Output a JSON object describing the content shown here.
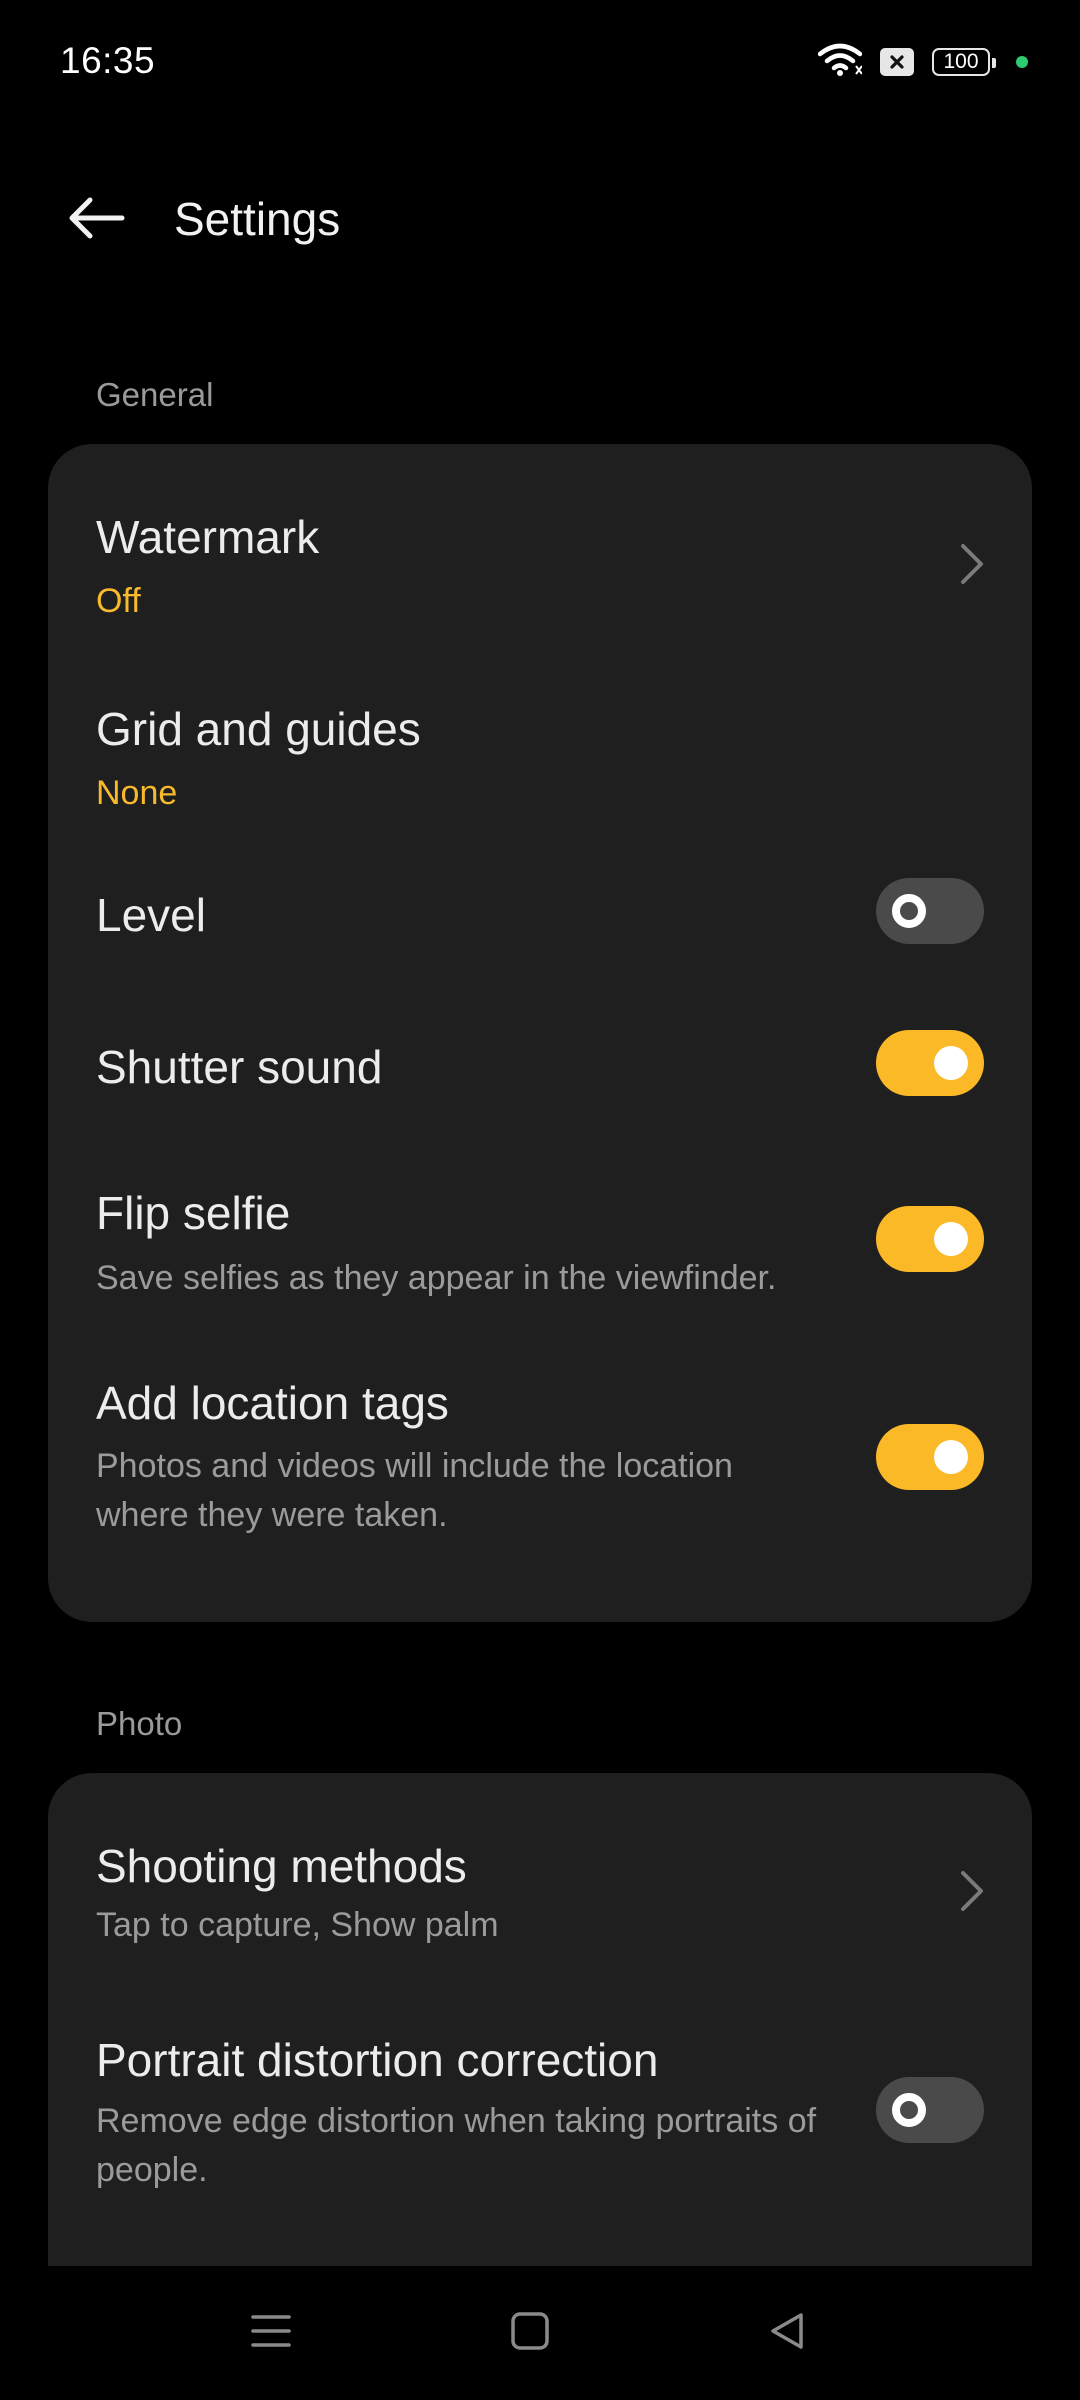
{
  "status_bar": {
    "time": "16:35",
    "battery": "100",
    "icons": [
      "wifi-icon",
      "sim-off-icon",
      "battery-icon",
      "privacy-indicator-dot"
    ]
  },
  "header": {
    "title": "Settings",
    "back_icon": "arrow-left-icon"
  },
  "sections": {
    "general": {
      "label": "General",
      "items": {
        "watermark": {
          "title": "Watermark",
          "value": "Off"
        },
        "grid": {
          "title": "Grid and guides",
          "value": "None"
        },
        "level": {
          "title": "Level",
          "toggle": false
        },
        "shutter": {
          "title": "Shutter sound",
          "toggle": true
        },
        "flip_selfie": {
          "title": "Flip selfie",
          "subtitle": "Save selfies as they appear in the viewfinder.",
          "toggle": true
        },
        "location": {
          "title": "Add location tags",
          "subtitle": "Photos and videos will include the location where they were taken.",
          "toggle": true
        }
      }
    },
    "photo": {
      "label": "Photo",
      "items": {
        "shooting_methods": {
          "title": "Shooting methods",
          "subtitle": "Tap to capture, Show palm"
        },
        "portrait_distortion": {
          "title": "Portrait distortion correction",
          "subtitle": "Remove edge distortion when taking portraits of people.",
          "toggle": false
        }
      }
    }
  },
  "colors": {
    "accent": "#fbb927",
    "card_bg": "#1f1f1f",
    "background": "#000000",
    "toggle_off": "#4a4a4a"
  },
  "nav_bar": {
    "icons": [
      "menu-icon",
      "home-square-icon",
      "back-triangle-icon"
    ]
  }
}
